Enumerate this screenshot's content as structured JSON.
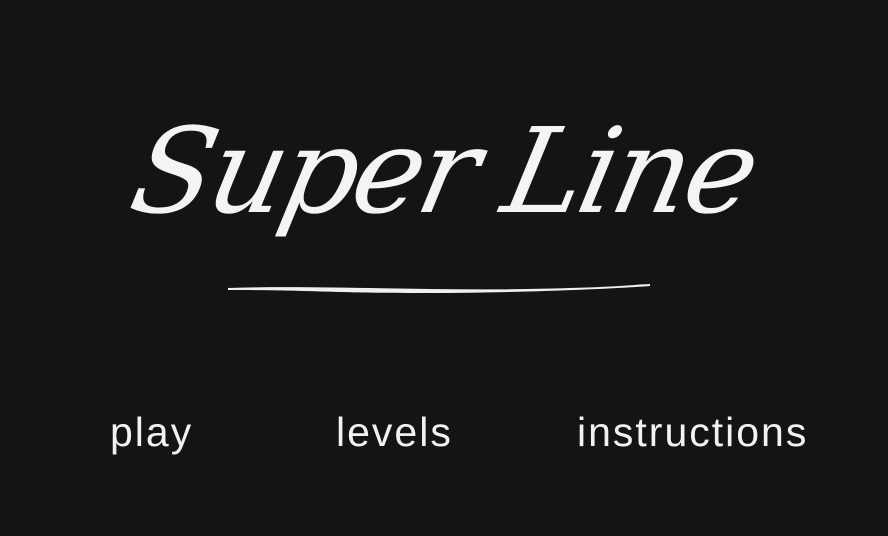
{
  "title": {
    "logo_text": "Super Line"
  },
  "menu": {
    "play": "play",
    "levels": "levels",
    "instructions": "instructions"
  },
  "colors": {
    "background": "#141414",
    "foreground": "#ffffff"
  }
}
